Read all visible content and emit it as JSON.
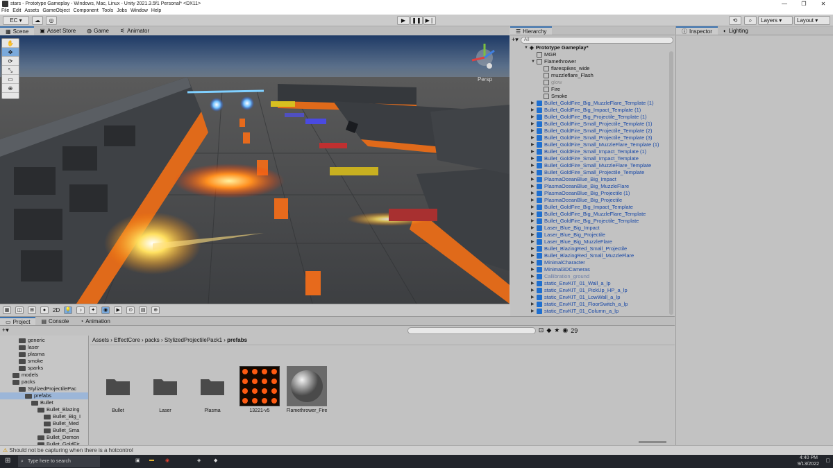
{
  "window": {
    "title": "stars - Prototype Gameplay - Windows, Mac, Linux - Unity 2021.3.5f1 Personal* <DX11>"
  },
  "menu": [
    "File",
    "Edit",
    "Assets",
    "GameObject",
    "Component",
    "Tools",
    "Jobs",
    "Window",
    "Help"
  ],
  "toolbar": {
    "account": "EC",
    "layers": "Layers",
    "layout": "Layout"
  },
  "scene_tabs": [
    "Scene",
    "Asset Store",
    "Game",
    "Animator"
  ],
  "scene": {
    "gizmo_label": "Persp",
    "mode_2d": "2D"
  },
  "hierarchy": {
    "tab": "Hierarchy",
    "search_placeholder": "All",
    "scene_name": "Prototype Gameplay*",
    "items": [
      {
        "label": "MGR",
        "indent": 1,
        "style": "normal",
        "icon": "grey",
        "arrow": ""
      },
      {
        "label": "Flamethrower",
        "indent": 1,
        "style": "normal",
        "icon": "grey",
        "arrow": "▼"
      },
      {
        "label": "flarespikes_wide",
        "indent": 2,
        "style": "normal",
        "icon": "grey",
        "arrow": ""
      },
      {
        "label": "muzzleflare_Flash",
        "indent": 2,
        "style": "normal",
        "icon": "grey",
        "arrow": ""
      },
      {
        "label": "glow",
        "indent": 2,
        "style": "grey",
        "icon": "grey",
        "arrow": ""
      },
      {
        "label": "Fire",
        "indent": 2,
        "style": "normal",
        "icon": "grey",
        "arrow": ""
      },
      {
        "label": "Smoke",
        "indent": 2,
        "style": "normal",
        "icon": "grey",
        "arrow": ""
      },
      {
        "label": "Bullet_GoldFire_Big_MuzzleFlare_Template (1)",
        "indent": 1,
        "style": "blue",
        "icon": "blue",
        "arrow": "▶"
      },
      {
        "label": "Bullet_GoldFire_Big_Impact_Template (1)",
        "indent": 1,
        "style": "blue",
        "icon": "blue",
        "arrow": "▶"
      },
      {
        "label": "Bullet_GoldFire_Big_Projectile_Template (1)",
        "indent": 1,
        "style": "blue",
        "icon": "blue",
        "arrow": "▶"
      },
      {
        "label": "Bullet_GoldFire_Small_Projectile_Template (1)",
        "indent": 1,
        "style": "blue",
        "icon": "blue",
        "arrow": "▶"
      },
      {
        "label": "Bullet_GoldFire_Small_Projectile_Template (2)",
        "indent": 1,
        "style": "blue",
        "icon": "blue",
        "arrow": "▶"
      },
      {
        "label": "Bullet_GoldFire_Small_Projectile_Template (3)",
        "indent": 1,
        "style": "blue",
        "icon": "blue",
        "arrow": "▶"
      },
      {
        "label": "Bullet_GoldFire_Small_MuzzleFlare_Template (1)",
        "indent": 1,
        "style": "blue",
        "icon": "blue",
        "arrow": "▶"
      },
      {
        "label": "Bullet_GoldFire_Small_Impact_Template (1)",
        "indent": 1,
        "style": "blue",
        "icon": "blue",
        "arrow": "▶"
      },
      {
        "label": "Bullet_GoldFire_Small_Impact_Template",
        "indent": 1,
        "style": "blue",
        "icon": "blue",
        "arrow": "▶"
      },
      {
        "label": "Bullet_GoldFire_Small_MuzzleFlare_Template",
        "indent": 1,
        "style": "blue",
        "icon": "blue",
        "arrow": "▶"
      },
      {
        "label": "Bullet_GoldFire_Small_Projectile_Template",
        "indent": 1,
        "style": "blue",
        "icon": "blue",
        "arrow": "▶"
      },
      {
        "label": "PlasmaOceanBlue_Big_Impact",
        "indent": 1,
        "style": "blue",
        "icon": "blue",
        "arrow": "▶"
      },
      {
        "label": "PlasmaOceanBlue_Big_MuzzleFlare",
        "indent": 1,
        "style": "blue",
        "icon": "blue",
        "arrow": "▶"
      },
      {
        "label": "PlasmaOceanBlue_Big_Projectile (1)",
        "indent": 1,
        "style": "blue",
        "icon": "blue",
        "arrow": "▶"
      },
      {
        "label": "PlasmaOceanBlue_Big_Projectile",
        "indent": 1,
        "style": "blue",
        "icon": "blue",
        "arrow": "▶"
      },
      {
        "label": "Bullet_GoldFire_Big_Impact_Template",
        "indent": 1,
        "style": "blue",
        "icon": "blue",
        "arrow": "▶"
      },
      {
        "label": "Bullet_GoldFire_Big_MuzzleFlare_Template",
        "indent": 1,
        "style": "blue",
        "icon": "blue",
        "arrow": "▶"
      },
      {
        "label": "Bullet_GoldFire_Big_Projectile_Template",
        "indent": 1,
        "style": "blue",
        "icon": "blue",
        "arrow": "▶"
      },
      {
        "label": "Laser_Blue_Big_Impact",
        "indent": 1,
        "style": "blue",
        "icon": "blue",
        "arrow": "▶"
      },
      {
        "label": "Laser_Blue_Big_Projectile",
        "indent": 1,
        "style": "blue",
        "icon": "blue",
        "arrow": "▶"
      },
      {
        "label": "Laser_Blue_Big_MuzzleFlare",
        "indent": 1,
        "style": "blue",
        "icon": "blue",
        "arrow": "▶"
      },
      {
        "label": "Bullet_BlazingRed_Small_Projectile",
        "indent": 1,
        "style": "blue",
        "icon": "blue",
        "arrow": "▶"
      },
      {
        "label": "Bullet_BlazingRed_Small_MuzzleFlare",
        "indent": 1,
        "style": "blue",
        "icon": "blue",
        "arrow": "▶"
      },
      {
        "label": "MinimalCharacter",
        "indent": 1,
        "style": "blue",
        "icon": "blue",
        "arrow": "▶"
      },
      {
        "label": "Minimal3DCameras",
        "indent": 1,
        "style": "blue",
        "icon": "blue",
        "arrow": "▶"
      },
      {
        "label": "Callibration_ground",
        "indent": 1,
        "style": "greyblue",
        "icon": "blue",
        "arrow": "▶"
      },
      {
        "label": "static_EnvKIT_01_Wall_a_lp",
        "indent": 1,
        "style": "blue",
        "icon": "blue",
        "arrow": "▶"
      },
      {
        "label": "static_EnvKIT_01_PickUp_HP_a_lp",
        "indent": 1,
        "style": "blue",
        "icon": "blue",
        "arrow": "▶"
      },
      {
        "label": "static_EnvKIT_01_LowWall_a_lp",
        "indent": 1,
        "style": "blue",
        "icon": "blue",
        "arrow": "▶"
      },
      {
        "label": "static_EnvKIT_01_FloorSwitch_a_lp",
        "indent": 1,
        "style": "blue",
        "icon": "blue",
        "arrow": "▶"
      },
      {
        "label": "static_EnvKIT_01_Column_a_lp",
        "indent": 1,
        "style": "blue",
        "icon": "blue",
        "arrow": "▶"
      }
    ]
  },
  "inspector": {
    "tabs": [
      "Inspector",
      "Lighting"
    ]
  },
  "project": {
    "tabs": [
      "Project",
      "Console",
      "Animation"
    ],
    "count": "29",
    "breadcrumb": [
      "Assets",
      "EffectCore",
      "packs",
      "StylizedProjectilePack1",
      "prefabs"
    ],
    "tree": [
      {
        "label": "generic",
        "indent": 3,
        "sel": false
      },
      {
        "label": "laser",
        "indent": 3,
        "sel": false
      },
      {
        "label": "plasma",
        "indent": 3,
        "sel": false
      },
      {
        "label": "smoke",
        "indent": 3,
        "sel": false
      },
      {
        "label": "sparks",
        "indent": 3,
        "sel": false
      },
      {
        "label": "models",
        "indent": 2,
        "sel": false
      },
      {
        "label": "packs",
        "indent": 2,
        "sel": false
      },
      {
        "label": "StylizedProjectilePac",
        "indent": 3,
        "sel": false
      },
      {
        "label": "prefabs",
        "indent": 4,
        "sel": true
      },
      {
        "label": "Bullet",
        "indent": 5,
        "sel": false
      },
      {
        "label": "Bullet_Blazing",
        "indent": 6,
        "sel": false
      },
      {
        "label": "Bullet_Big_I",
        "indent": 7,
        "sel": false
      },
      {
        "label": "Bullet_Med",
        "indent": 7,
        "sel": false
      },
      {
        "label": "Bullet_Sma",
        "indent": 7,
        "sel": false
      },
      {
        "label": "Bullet_Demon",
        "indent": 6,
        "sel": false
      },
      {
        "label": "Bullet_GoldFir",
        "indent": 6,
        "sel": false
      }
    ],
    "assets": [
      {
        "label": "Bullet",
        "kind": "folder"
      },
      {
        "label": "Laser",
        "kind": "folder"
      },
      {
        "label": "Plasma",
        "kind": "folder"
      },
      {
        "label": "13221-v5",
        "kind": "sprites"
      },
      {
        "label": "Flamethrower_Fire",
        "kind": "material"
      }
    ]
  },
  "status": {
    "message": "Should not be capturing when there is a hotcontrol"
  },
  "taskbar": {
    "search_placeholder": "Type here to search",
    "time": "4:40 PM",
    "date": "9/13/2022"
  }
}
